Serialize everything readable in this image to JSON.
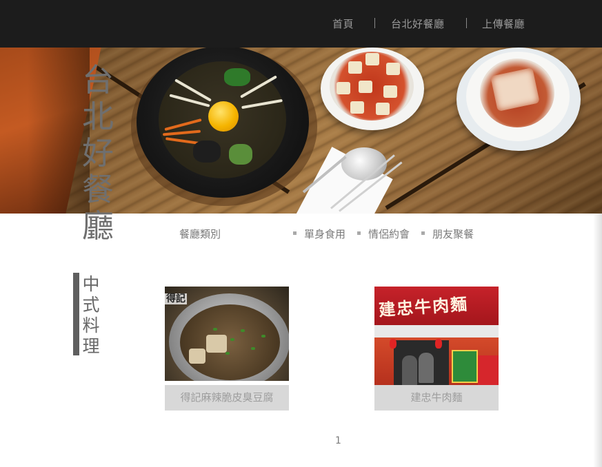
{
  "nav": {
    "items": [
      {
        "label": "首頁"
      },
      {
        "label": "台北好餐廳"
      },
      {
        "label": "上傳餐廳"
      }
    ]
  },
  "site_title": [
    "台",
    "北",
    "好",
    "餐",
    "廳"
  ],
  "categories": {
    "label": "餐廳類別",
    "tags": [
      {
        "label": "單身食用"
      },
      {
        "label": "情侶約會"
      },
      {
        "label": "朋友聚餐"
      }
    ]
  },
  "section": {
    "title": [
      "中",
      "式",
      "料",
      "理"
    ]
  },
  "restaurants": [
    {
      "name": "得記麻辣脆皮臭豆腐",
      "image_icon": "hotpot-photo",
      "photo_text": "得記"
    },
    {
      "name": "建忠牛肉麵",
      "image_icon": "storefront-photo",
      "photo_text": "建忠牛肉麵"
    }
  ],
  "pagination": {
    "current": "1"
  },
  "colors": {
    "nav_bg": "#1c1c1c",
    "nav_text": "#9a9a9a",
    "caption_bg": "#d8d8d8",
    "section_bar": "#5f5f5f"
  }
}
